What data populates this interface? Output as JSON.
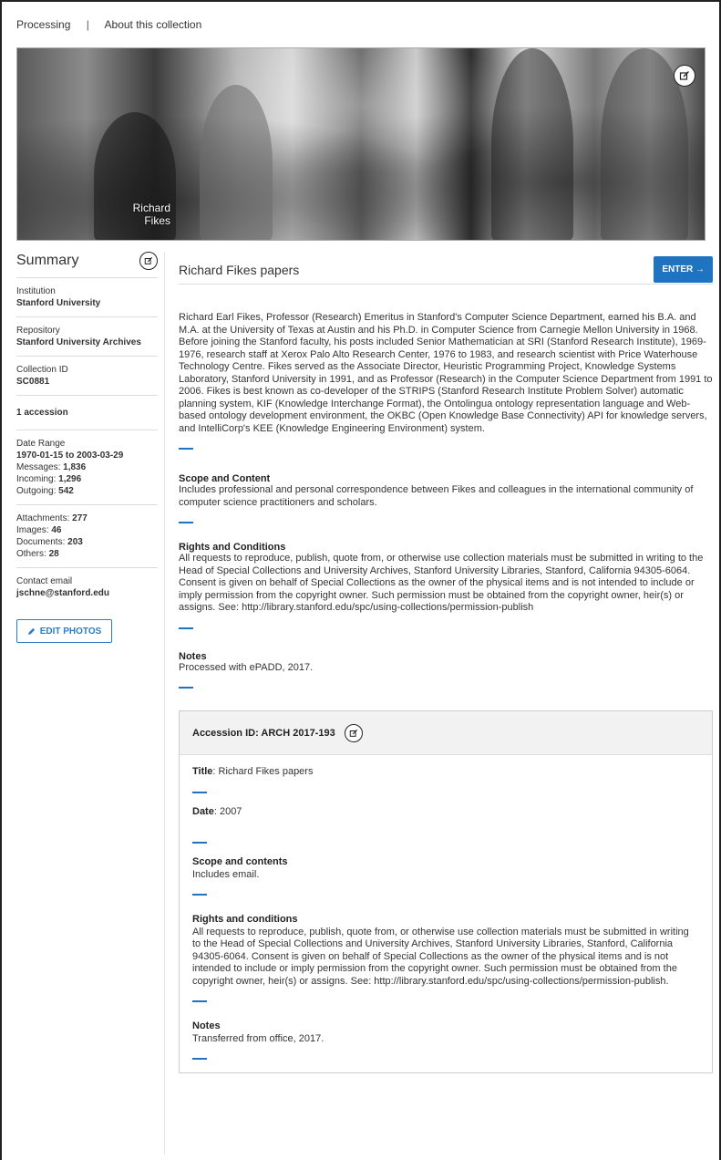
{
  "topnav": {
    "processing": "Processing",
    "separator": "|",
    "about": "About this collection"
  },
  "hero": {
    "caption_line1": "Richard",
    "caption_line2": "Fikes"
  },
  "sidebar": {
    "title": "Summary",
    "institution_label": "Institution",
    "institution_value": "Stanford University",
    "repository_label": "Repository",
    "repository_value": "Stanford University Archives",
    "collection_id_label": "Collection ID",
    "collection_id_value": "SC0881",
    "accessions": "1 accession",
    "date_range_label": "Date Range",
    "date_range_value": "1970-01-15 to 2003-03-29",
    "messages_label": "Messages:",
    "messages_value": "1,836",
    "incoming_label": "Incoming:",
    "incoming_value": "1,296",
    "outgoing_label": "Outgoing:",
    "outgoing_value": "542",
    "attachments_label": "Attachments:",
    "attachments_value": "277",
    "images_label": "Images:",
    "images_value": "46",
    "documents_label": "Documents:",
    "documents_value": "203",
    "others_label": "Others:",
    "others_value": "28",
    "contact_label": "Contact email",
    "contact_value": "jschne@stanford.edu",
    "edit_photos": "EDIT PHOTOS"
  },
  "main": {
    "title": "Richard Fikes papers",
    "enter": "ENTER →",
    "description": "Richard Earl Fikes, Professor (Research) Emeritus in Stanford's Computer Science Department, earned his B.A. and M.A. at the University of Texas at Austin and his Ph.D. in Computer Science from Carnegie Mellon University in 1968. Before joining the Stanford faculty, his posts included Senior Mathematician at SRI (Stanford Research Institute), 1969-1976, research staff at Xerox Palo Alto Research Center, 1976 to 1983, and research scientist with Price Waterhouse Technology Centre. Fikes served as the Associate Director, Heuristic Programming Project, Knowledge Systems Laboratory, Stanford University in 1991, and as Professor (Research) in the Computer Science Department from 1991 to 2006. Fikes is best known as co-developer of the STRIPS (Stanford Research Institute Problem Solver) automatic planning system, KIF (Knowledge Interchange Format), the Ontolingua ontology representation language and Web-based ontology development environment, the OKBC (Open Knowledge Base Connectivity) API for knowledge servers, and IntelliCorp's KEE (Knowledge Engineering Environment) system.",
    "scope_title": "Scope and Content",
    "scope_body": "Includes professional and personal correspondence between Fikes and colleagues in the international community of computer science practitioners and scholars.",
    "rights_title": "Rights and Conditions",
    "rights_body": "All requests to reproduce, publish, quote from, or otherwise use collection materials must be submitted in writing to the Head of Special Collections and University Archives, Stanford University Libraries, Stanford, California 94305-6064. Consent is given on behalf of Special Collections as the owner of the physical items and is not intended to include or imply permission from the copyright owner. Such permission must be obtained from the copyright owner, heir(s) or assigns. See: http://library.stanford.edu/spc/using-collections/permission-publish",
    "notes_title": "Notes",
    "notes_body": "Processed with ePADD, 2017."
  },
  "accession": {
    "header": "Accession ID: ARCH 2017-193",
    "title_label": "Title",
    "title_value": ": Richard Fikes papers",
    "date_label": "Date",
    "date_value": ": 2007",
    "scope_title": "Scope and contents",
    "scope_body": "Includes email.",
    "rights_title": "Rights and conditions",
    "rights_body": "All requests to reproduce, publish, quote from, or otherwise use collection materials must be submitted in writing to the Head of Special Collections and University Archives, Stanford University Libraries, Stanford, California 94305-6064. Consent is given on behalf of Special Collections as the owner of the physical items and is not intended to include or imply permission from the copyright owner. Such permission must be obtained from the copyright owner, heir(s) or assigns. See: http://library.stanford.edu/spc/using-collections/permission-publish.",
    "notes_title": "Notes",
    "notes_body": "Transferred from office, 2017."
  },
  "colors": {
    "accent": "#1f74c2",
    "border": "#dddddd",
    "panel": "#f2f2f2"
  },
  "icons": {
    "edit": "edit-icon",
    "pencil": "pencil-icon"
  }
}
